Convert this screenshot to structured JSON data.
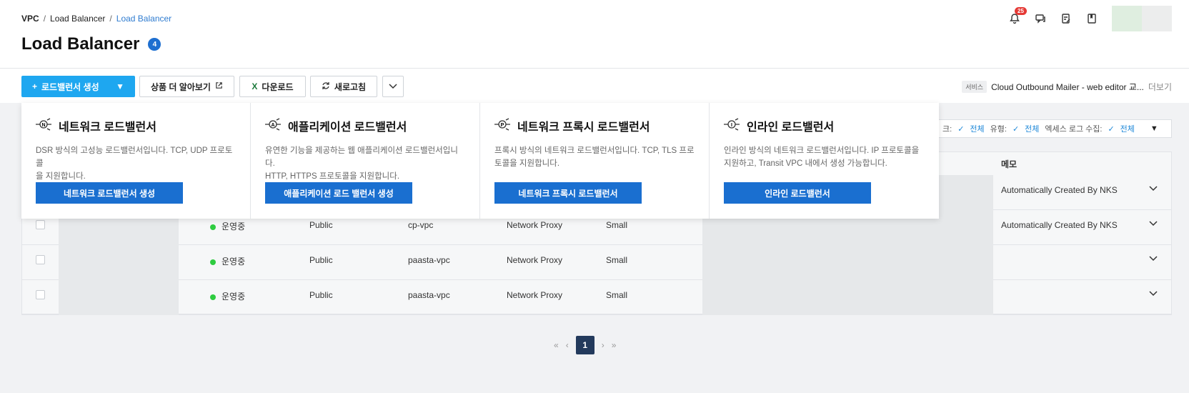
{
  "breadcrumb": [
    "VPC",
    "Load Balancer",
    "Load Balancer"
  ],
  "page": {
    "title": "Load Balancer",
    "count": "4"
  },
  "header": {
    "notification_count": "25"
  },
  "toolbar": {
    "create_label": "로드밸런서 생성",
    "learn_more_label": "상품 더 알아보기",
    "download_label": "다운로드",
    "refresh_label": "새로고침",
    "service_tag": "서비스",
    "service_name": "Cloud Outbound Mailer - web editor 교...",
    "more_label": "더보기"
  },
  "filters": {
    "network_label": "크:",
    "network_value": "전체",
    "type_label": "유형:",
    "type_value": "전체",
    "access_log_label": "엑세스 로그 수집:",
    "access_log_value": "전체"
  },
  "table": {
    "memo_header": "메모",
    "rows": [
      {
        "status": "",
        "access": "",
        "vpc": "",
        "type": "",
        "size": "",
        "memo": "Automatically Created By NKS"
      },
      {
        "status": "운영중",
        "access": "Public",
        "vpc": "cp-vpc",
        "type": "Network Proxy",
        "size": "Small",
        "memo": "Automatically Created By NKS"
      },
      {
        "status": "운영중",
        "access": "Public",
        "vpc": "paasta-vpc",
        "type": "Network Proxy",
        "size": "Small",
        "memo": ""
      },
      {
        "status": "운영중",
        "access": "Public",
        "vpc": "paasta-vpc",
        "type": "Network Proxy",
        "size": "Small",
        "memo": ""
      }
    ]
  },
  "pager": {
    "current": "1"
  },
  "dropdown": [
    {
      "icon": "network-lb-icon",
      "letter": "N",
      "title": "네트워크 로드밸런서",
      "desc1": "DSR 방식의 고성능 로드밸런서입니다. TCP, UDP 프로토콜",
      "desc2": "을 지원합니다.",
      "button": "네트워크 로드밸런서 생성"
    },
    {
      "icon": "application-lb-icon",
      "letter": "A",
      "title": "애플리케이션 로드밸런서",
      "desc1": "유연한 기능을 제공하는 웹 애플리케이션 로드밸런서입니다.",
      "desc2": "HTTP, HTTPS 프로토콜을 지원합니다.",
      "button": "애플리케이션 로드 밸런서 생성"
    },
    {
      "icon": "network-proxy-lb-icon",
      "letter": "P",
      "title": "네트워크 프록시 로드밸런서",
      "desc1": "프록시 방식의 네트워크 로드밸런서입니다. TCP, TLS 프로",
      "desc2": "토콜을 지원합니다.",
      "button": "네트워크 프록시 로드밸런서"
    },
    {
      "icon": "inline-lb-icon",
      "letter": "I",
      "title": "인라인 로드밸런서",
      "desc1": "인라인 방식의 네트워크 로드밸런서입니다. IP 프로토콜을",
      "desc2": "지원하고, Transit VPC 내에서 생성 가능합니다.",
      "button": "인라인 로드밸런서"
    }
  ]
}
